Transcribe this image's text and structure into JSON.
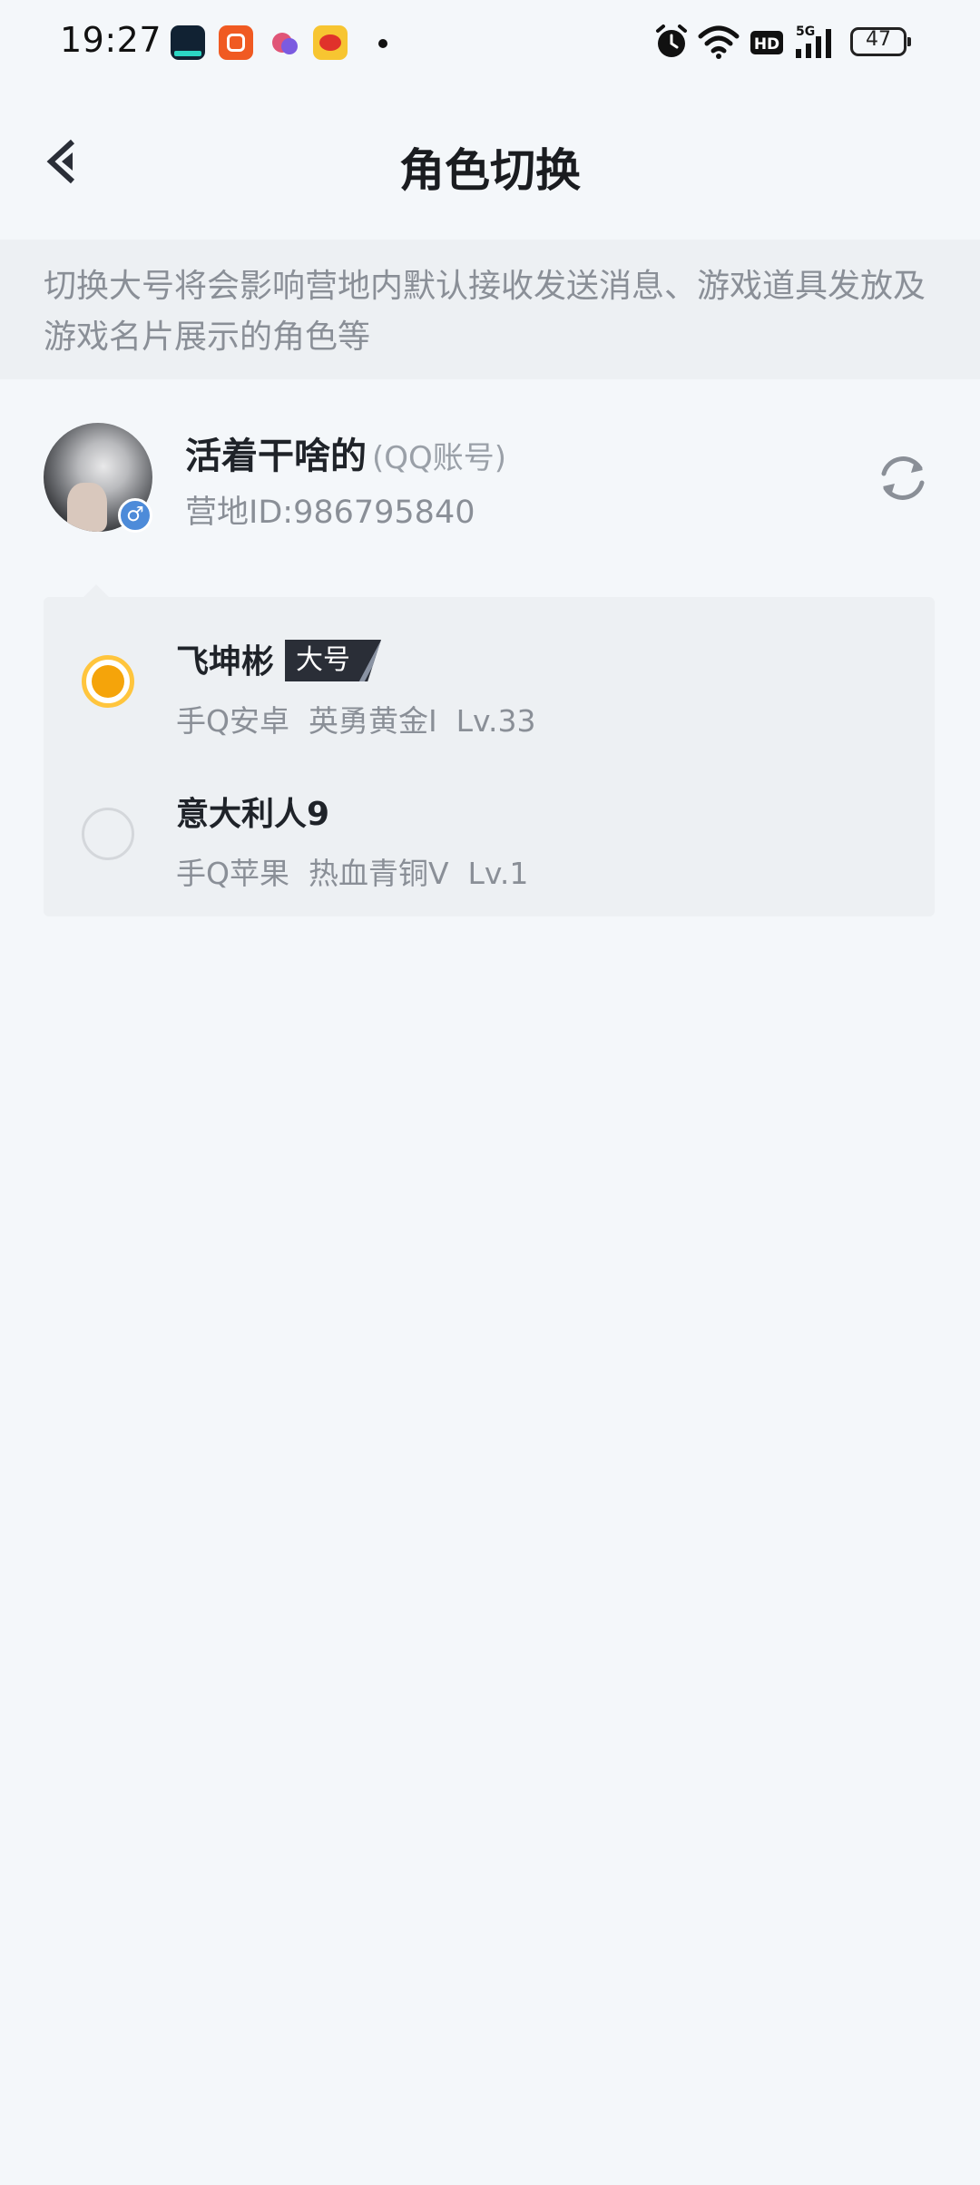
{
  "status_bar": {
    "time": "19:27",
    "battery_level": "47",
    "icons": [
      "app-icon-1",
      "app-icon-2",
      "app-icon-3",
      "weibo-icon",
      "notification-dot",
      "alarm-icon",
      "wifi-icon",
      "hd-icon",
      "signal-5g-icon",
      "battery-icon"
    ]
  },
  "header": {
    "title": "角色切换",
    "back_icon": "chevron-left-icon"
  },
  "notice": {
    "text": "切换大号将会影响营地内默认接收发送消息、游戏道具发放及游戏名片展示的角色等"
  },
  "account": {
    "name": "活着干啥的",
    "type": "(QQ账号)",
    "id_label": "营地ID:986795840",
    "gender_symbol": "♂",
    "refresh_icon": "refresh-icon"
  },
  "roles": [
    {
      "name": "飞坤彬",
      "badge": "大号",
      "info": "手Q安卓  英勇黄金I  Lv.33",
      "selected": true
    },
    {
      "name": "意大利人9",
      "badge": "",
      "info": "手Q苹果  热血青铜V  Lv.1",
      "selected": false
    }
  ],
  "colors": {
    "background": "#f4f7fa",
    "notice_bg": "#edf0f3",
    "radio_selected": "#f5a40a",
    "badge_bg": "#2a2e37",
    "gender_badge": "#4d8bd9"
  }
}
